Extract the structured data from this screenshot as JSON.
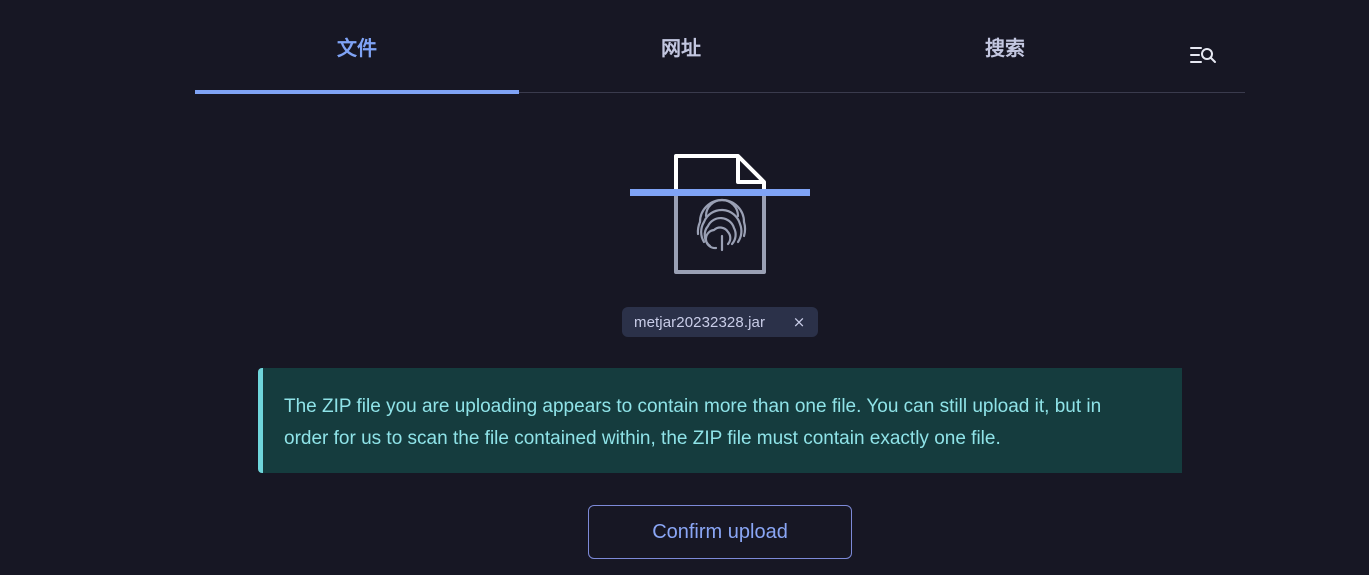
{
  "tabs": [
    {
      "label": "文件",
      "active": true
    },
    {
      "label": "网址",
      "active": false
    },
    {
      "label": "搜索",
      "active": false
    }
  ],
  "icons": {
    "advanced_search": "search-list-icon",
    "file": "fingerprint-document-icon",
    "remove": "close-icon"
  },
  "upload": {
    "filename": "metjar20232328.jar",
    "remove_glyph": "×"
  },
  "alert": {
    "message": "The ZIP file you are uploading appears to contain more than one file. You can still upload it, but in order for us to scan the file contained within, the ZIP file must contain exactly one file."
  },
  "actions": {
    "confirm_label": "Confirm upload"
  },
  "colors": {
    "background": "#171724",
    "accent": "#7fa3f5",
    "alert_bg": "#153c3e",
    "alert_border": "#6fd6dc",
    "alert_text": "#8fe3e8"
  }
}
